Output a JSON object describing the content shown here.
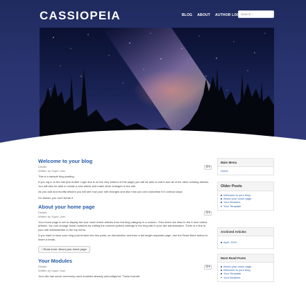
{
  "site": {
    "brand": "CASSIOPEIA"
  },
  "nav": {
    "items": [
      {
        "label": "BLOG"
      },
      {
        "label": "ABOUT"
      },
      {
        "label": "AUTHOR LOGIN"
      }
    ],
    "search_placeholder": "Search..."
  },
  "articles": [
    {
      "title": "Welcome to your blog",
      "details": "Details",
      "author": "Written by Super User",
      "paragraphs": [
        "This is a sample blog posting.",
        "If you log in to the site (the Author Login link is on the very bottom of this page) you will be able to edit it and all of the other existing articles. You will also be able to create a new article and make other changes to the site.",
        "As you add and modify articles you will see how your site changes and also how you can customise it in various ways.",
        "Go ahead, you can't break it."
      ]
    },
    {
      "title": "About your home page",
      "details": "Details",
      "author": "Written by Super User",
      "paragraphs": [
        "Your home page is set to display the four most recent articles from the blog category in a column. Then there are links to the 4 next oldest articles. You can change those numbers by editing the content options settings in the blog tab in your site administrator. There is a link to your site administrator in the top menu.",
        "If you want to have your blog post broken into two parts, an introduction and then a full length separate page, use the Read More button to insert a break."
      ],
      "read_more": "Read more: About your home page"
    },
    {
      "title": "Your Modules",
      "details": "Details",
      "author": "Written by Super User",
      "paragraphs": [
        "Your site has some commonly used modules already preconfigured. These include:"
      ]
    }
  ],
  "sidebar": {
    "main_menu": {
      "title": "Main Menu",
      "items": [
        "Home"
      ]
    },
    "older_posts": {
      "title": "Older Posts",
      "items": [
        "Welcome to your blog",
        "About your home page",
        "Your Modules",
        "Your Template"
      ]
    },
    "archived": {
      "title": "Archived Articles",
      "items": [
        "April, 2019"
      ]
    },
    "most_read": {
      "title": "Most Read Posts",
      "items": [
        "About your home page",
        "Welcome to your blog",
        "Your Template",
        "Your Modules"
      ]
    }
  },
  "colors": {
    "header": "#2a3470",
    "link": "#2a5ca8"
  }
}
